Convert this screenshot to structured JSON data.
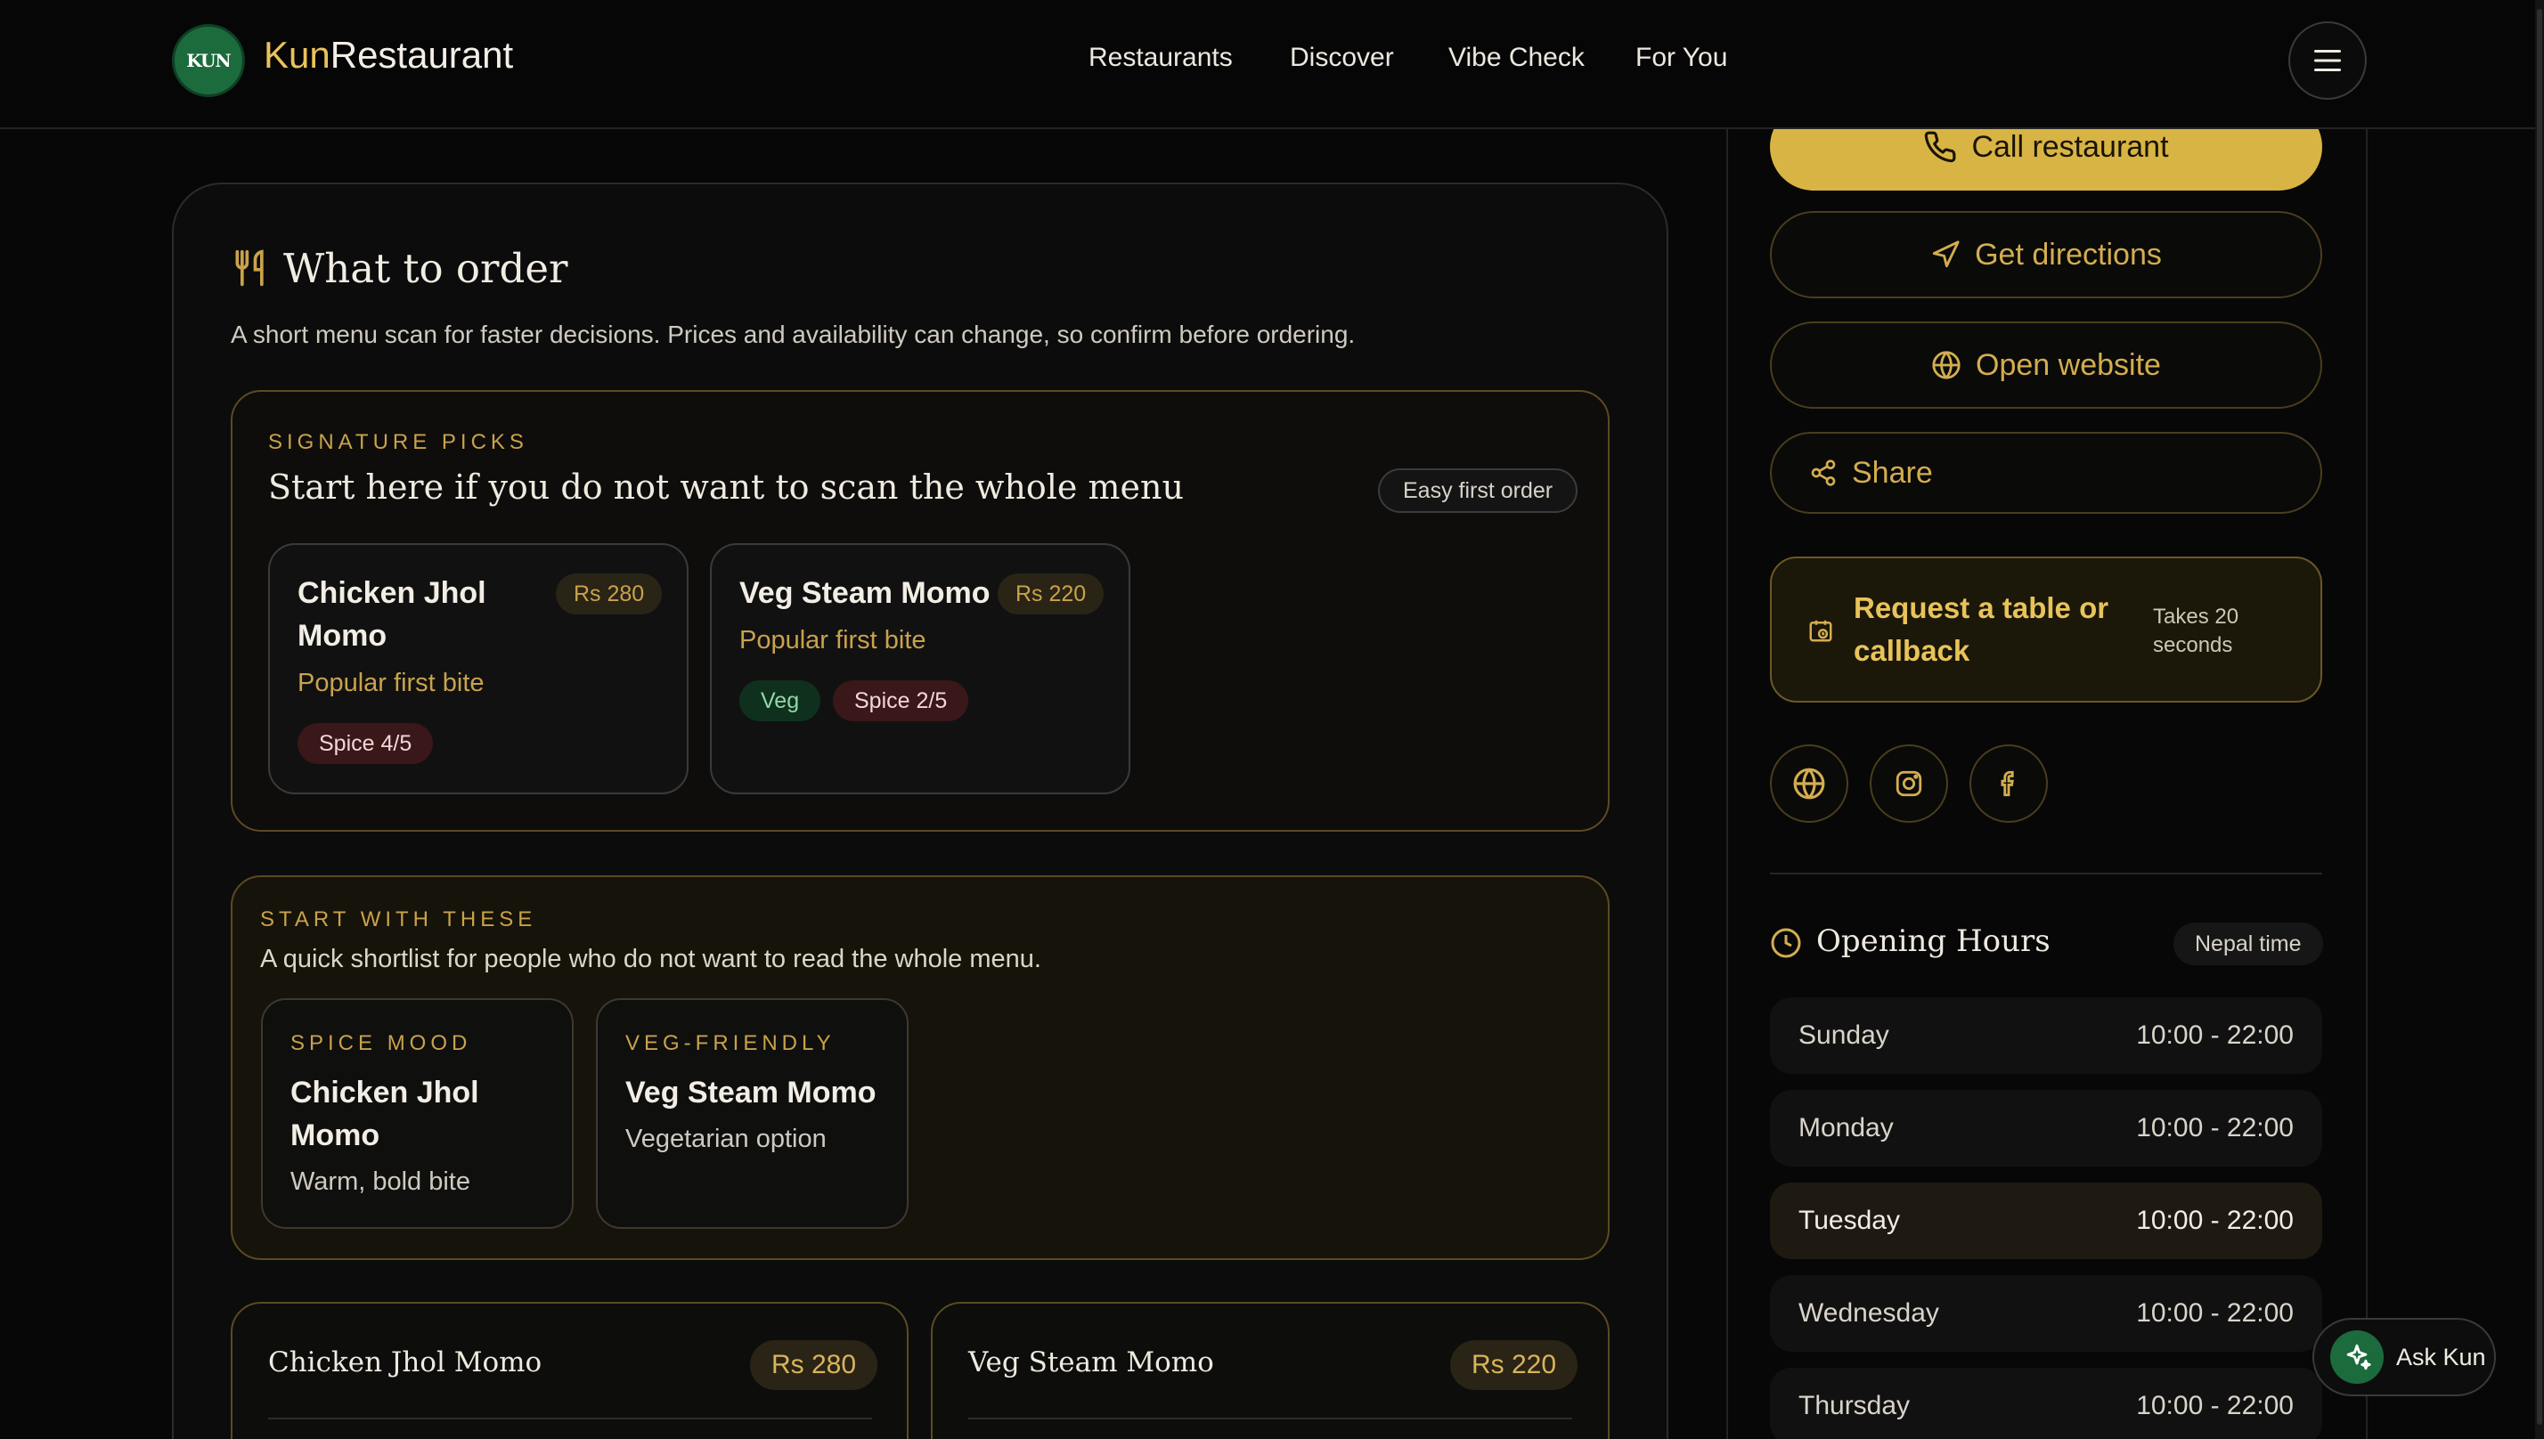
{
  "header": {
    "logo_text": "KUN",
    "brand_prefix": "Kun",
    "brand_suffix": "Restaurant",
    "nav": [
      "Restaurants",
      "Discover",
      "Vibe Check",
      "For You"
    ]
  },
  "what_to_order": {
    "title": "What to order",
    "description": "A short menu scan for faster decisions. Prices and availability can change, so confirm before ordering.",
    "signature": {
      "eyebrow": "SIGNATURE PICKS",
      "heading": "Start here if you do not want to scan the whole menu",
      "badge": "Easy first order",
      "dishes": [
        {
          "name_line1": "Chicken Jhol",
          "name_line2": "Momo",
          "price": "Rs 280",
          "sub": "Popular first bite",
          "tags": [
            "Spice 4/5"
          ]
        },
        {
          "name_line1": "Veg Steam Momo",
          "name_line2": "",
          "price": "Rs 220",
          "sub": "Popular first bite",
          "tags": [
            "Veg",
            "Spice 2/5"
          ]
        }
      ]
    },
    "start_with": {
      "eyebrow": "START WITH THESE",
      "description": "A quick shortlist for people who do not want to read the whole menu.",
      "cards": [
        {
          "eyebrow": "SPICE MOOD",
          "name_line1": "Chicken Jhol",
          "name_line2": "Momo",
          "sub": "Warm, bold bite"
        },
        {
          "eyebrow": "VEG-FRIENDLY",
          "name_line1": "Veg Steam Momo",
          "name_line2": "",
          "sub": "Vegetarian option"
        }
      ]
    },
    "menu_items": [
      {
        "name": "Chicken Jhol Momo",
        "price": "Rs 280"
      },
      {
        "name": "Veg Steam Momo",
        "price": "Rs 220"
      }
    ]
  },
  "sidebar": {
    "call_label": "Call restaurant",
    "directions_label": "Get directions",
    "website_label": "Open website",
    "share_label": "Share",
    "request_line1": "Request a table or",
    "request_line2": "callback",
    "request_note_line1": "Takes 20",
    "request_note_line2": "seconds",
    "hours_title": "Opening Hours",
    "hours_badge": "Nepal time",
    "hours": [
      {
        "day": "Sunday",
        "time": "10:00 - 22:00"
      },
      {
        "day": "Monday",
        "time": "10:00 - 22:00"
      },
      {
        "day": "Tuesday",
        "time": "10:00 - 22:00"
      },
      {
        "day": "Wednesday",
        "time": "10:00 - 22:00"
      },
      {
        "day": "Thursday",
        "time": "10:00 - 22:00"
      }
    ]
  },
  "ask_kun_label": "Ask Kun",
  "colors": {
    "accent_gold": "#d8b444",
    "brand_green": "#1c6b3c",
    "background": "#070707"
  }
}
